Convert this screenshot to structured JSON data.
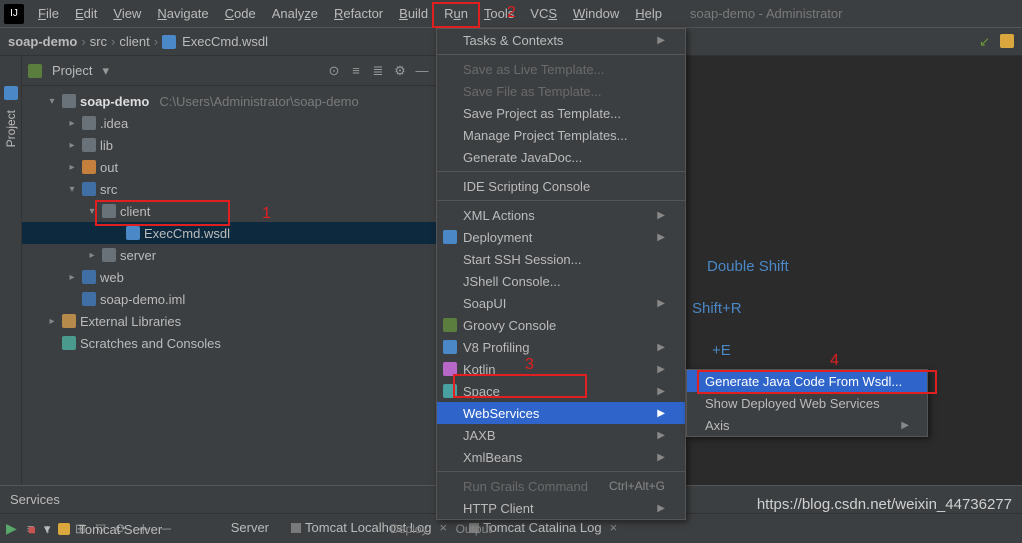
{
  "menubar": {
    "items": [
      "File",
      "Edit",
      "View",
      "Navigate",
      "Code",
      "Analyze",
      "Refactor",
      "Build",
      "Run",
      "Tools",
      "VCS",
      "Window",
      "Help"
    ],
    "title": "soap-demo - Administrator"
  },
  "breadcrumb": {
    "parts": [
      "soap-demo",
      "src",
      "client",
      "ExecCmd.wsdl"
    ]
  },
  "project_title": "Project",
  "tree": {
    "root": {
      "label": "soap-demo",
      "path": "C:\\Users\\Administrator\\soap-demo"
    },
    "idea": ".idea",
    "lib": "lib",
    "out": "out",
    "src": "src",
    "client": "client",
    "file": "ExecCmd.wsdl",
    "server": "server",
    "web": "web",
    "iml": "soap-demo.iml",
    "ext": "External Libraries",
    "scratch": "Scratches and Consoles"
  },
  "hints": {
    "h1": "Double Shift",
    "h2": "Shift+R",
    "h3": "+E"
  },
  "tools_menu": {
    "tasks": "Tasks & Contexts",
    "save_live": "Save as Live Template...",
    "save_file_tpl": "Save File as Template...",
    "save_proj_tpl": "Save Project as Template...",
    "manage_tpl": "Manage Project Templates...",
    "gen_javadoc": "Generate JavaDoc...",
    "ide_script": "IDE Scripting Console",
    "xml_actions": "XML Actions",
    "deployment": "Deployment",
    "start_ssh": "Start SSH Session...",
    "jshell": "JShell Console...",
    "soapui": "SoapUI",
    "groovy": "Groovy Console",
    "v8": "V8 Profiling",
    "kotlin": "Kotlin",
    "space": "Space",
    "webservices": "WebServices",
    "jaxb": "JAXB",
    "xmlbeans": "XmlBeans",
    "grails": "Run Grails Command",
    "grails_sc": "Ctrl+Alt+G",
    "http": "HTTP Client"
  },
  "ws_submenu": {
    "gen": "Generate Java Code From Wsdl...",
    "show": "Show Deployed Web Services",
    "axis": "Axis"
  },
  "annotations": {
    "n1": "1",
    "n2": "2",
    "n3": "3",
    "n4": "4"
  },
  "services_label": "Services",
  "bottom": {
    "server_tab": "Server",
    "tomcat_server": "Tomcat Server",
    "log1": "Tomcat Localhost Log",
    "log2": "Tomcat Catalina Log",
    "deploy": "Deploy",
    "output": "Output"
  },
  "sidebar_vtab": "Project",
  "watermark": "https://blog.csdn.net/weixin_44736277"
}
